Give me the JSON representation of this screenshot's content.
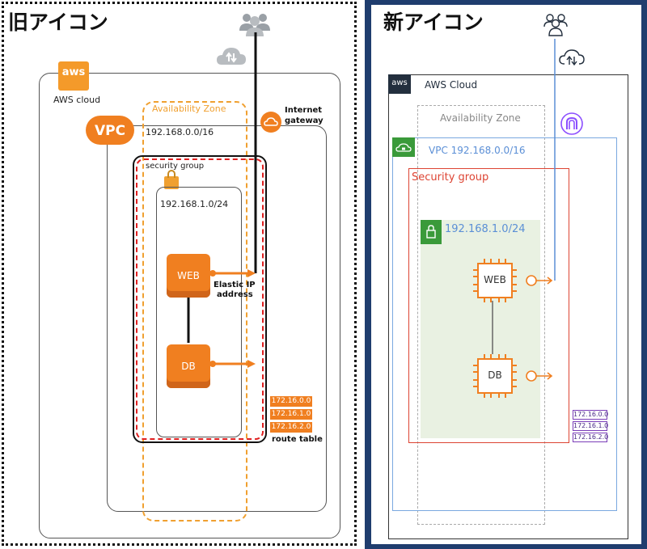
{
  "left": {
    "title": "旧アイコン",
    "aws_logo": "aws",
    "aws_cloud_label": "AWS cloud",
    "vpc_logo": "VPC",
    "vpc_cidr": "192.168.0.0/16",
    "az_label": "Availability Zone",
    "igw_label_line1": "Internet",
    "igw_label_line2": "gateway",
    "sg_label": "security group",
    "subnet_cidr": "192.168.1.0/24",
    "web_label": "WEB",
    "db_label": "DB",
    "eip_line1": "Elastic IP",
    "eip_line2": "address",
    "routes": [
      "172.16.0.0",
      "172.16.1.0",
      "172.16.2.0"
    ],
    "route_table_label": "route table"
  },
  "right": {
    "title": "新アイコン",
    "aws_logo": "aws",
    "aws_cloud_label": "AWS Cloud",
    "az_label": "Availability Zone",
    "vpc_label": "VPC 192.168.0.0/16",
    "sg_label": "Security group",
    "subnet_cidr": "192.168.1.0/24",
    "web_label": "WEB",
    "db_label": "DB",
    "routes": [
      "172.16.0.0",
      "172.16.1.0",
      "172.16.2.0"
    ]
  },
  "icons": {
    "users": "users-icon",
    "cloud_sync": "cloud-sync-icon",
    "internet_gateway": "internet-gateway-icon",
    "lock": "lock-icon",
    "ec2": "ec2-instance-icon",
    "elastic_ip": "elastic-ip-icon"
  },
  "colors": {
    "aws_orange": "#f07f20",
    "az_orange": "#f0a030",
    "sg_red": "#dd4433",
    "vpc_blue": "#7aa8e0",
    "subnet_green": "#3a9a3a",
    "route_purple": "#7a3db8",
    "right_frame": "#1f3d6e"
  }
}
